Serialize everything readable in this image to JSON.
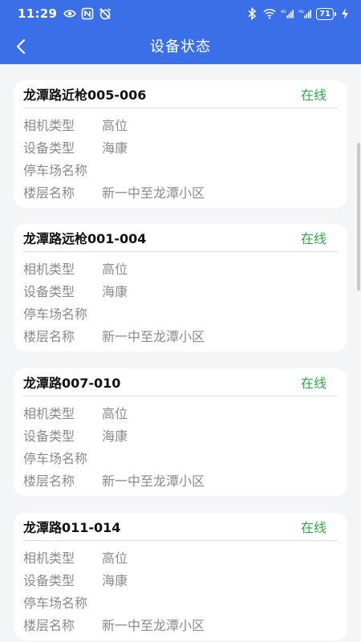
{
  "status_bar": {
    "time": "11:29",
    "battery": "71"
  },
  "app_bar": {
    "title": "设备状态"
  },
  "labels": {
    "camera_type": "相机类型",
    "device_type": "设备类型",
    "parking_name": "停车场名称",
    "floor_name": "楼层名称"
  },
  "devices": [
    {
      "name": "龙潭路近枪005-006",
      "status": "在线",
      "camera_type": "高位",
      "device_type": "海康",
      "parking_name": "",
      "floor_name": "新一中至龙潭小区"
    },
    {
      "name": "龙潭路远枪001-004",
      "status": "在线",
      "camera_type": "高位",
      "device_type": "海康",
      "parking_name": "",
      "floor_name": "新一中至龙潭小区"
    },
    {
      "name": "龙潭路007-010",
      "status": "在线",
      "camera_type": "高位",
      "device_type": "海康",
      "parking_name": "",
      "floor_name": "新一中至龙潭小区"
    },
    {
      "name": "龙潭路011-014",
      "status": "在线",
      "camera_type": "高位",
      "device_type": "海康",
      "parking_name": "",
      "floor_name": "新一中至龙潭小区"
    }
  ],
  "colors": {
    "primary": "#3b6fe8",
    "online": "#2eaa4a",
    "background": "#f4f5f7"
  }
}
